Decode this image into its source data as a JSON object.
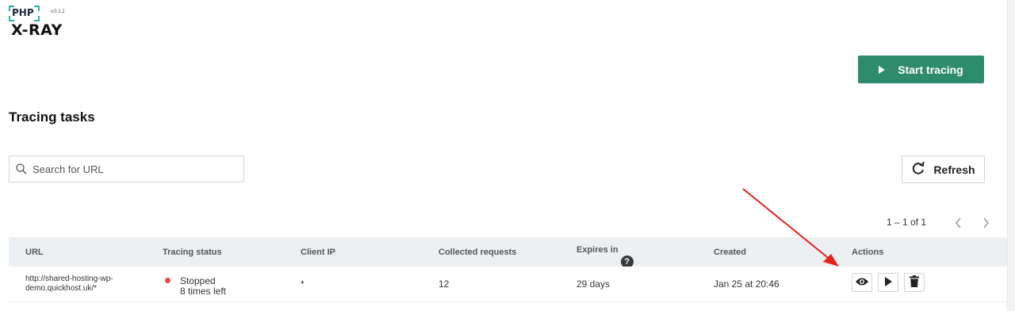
{
  "logo": {
    "php_label": "PHP",
    "version": "v.0.1.2",
    "name": "X-RAY"
  },
  "toolbar": {
    "start_label": "Start tracing",
    "refresh_label": "Refresh"
  },
  "page": {
    "title": "Tracing tasks"
  },
  "search": {
    "placeholder": "Search for URL"
  },
  "pagination": {
    "range_text": "1 – 1 of 1"
  },
  "table": {
    "columns": [
      "URL",
      "Tracing status",
      "Client IP",
      "Collected requests",
      "Expires in",
      "Created",
      "Actions"
    ],
    "rows": [
      {
        "url_line1": "http://shared-hosting-wp-",
        "url_line2": "demo.quickhost.uk/*",
        "status": "Stopped",
        "status_sub": "8 times left",
        "client_ip": "*",
        "collected": "12",
        "expires": "29 days",
        "created": "Jan 25 at 20:46"
      }
    ]
  },
  "icons": {
    "help": "?",
    "actions": [
      "eye-icon",
      "play-icon",
      "trash-icon"
    ]
  },
  "colors": {
    "accent": "#2e8b6b",
    "status_stopped": "#e5484d",
    "logo_bracket": "#2bb3a8",
    "arrow": "#e8201f"
  }
}
